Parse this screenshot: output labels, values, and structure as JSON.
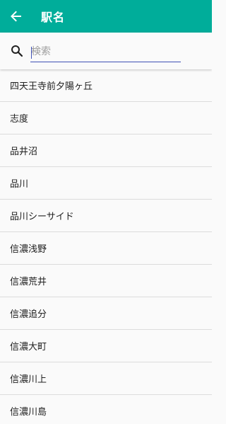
{
  "toolbar": {
    "title": "駅名",
    "back_icon": "arrow-back-icon",
    "background_color": "#00ad9a"
  },
  "search": {
    "placeholder": "検索",
    "value": "",
    "icon": "search-icon",
    "underline_color": "#3f51b5"
  },
  "stations": [
    "四天王寺前夕陽ヶ丘",
    "志度",
    "品井沼",
    "品川",
    "品川シーサイド",
    "信濃浅野",
    "信濃荒井",
    "信濃追分",
    "信濃大町",
    "信濃川上",
    "信濃川島"
  ]
}
